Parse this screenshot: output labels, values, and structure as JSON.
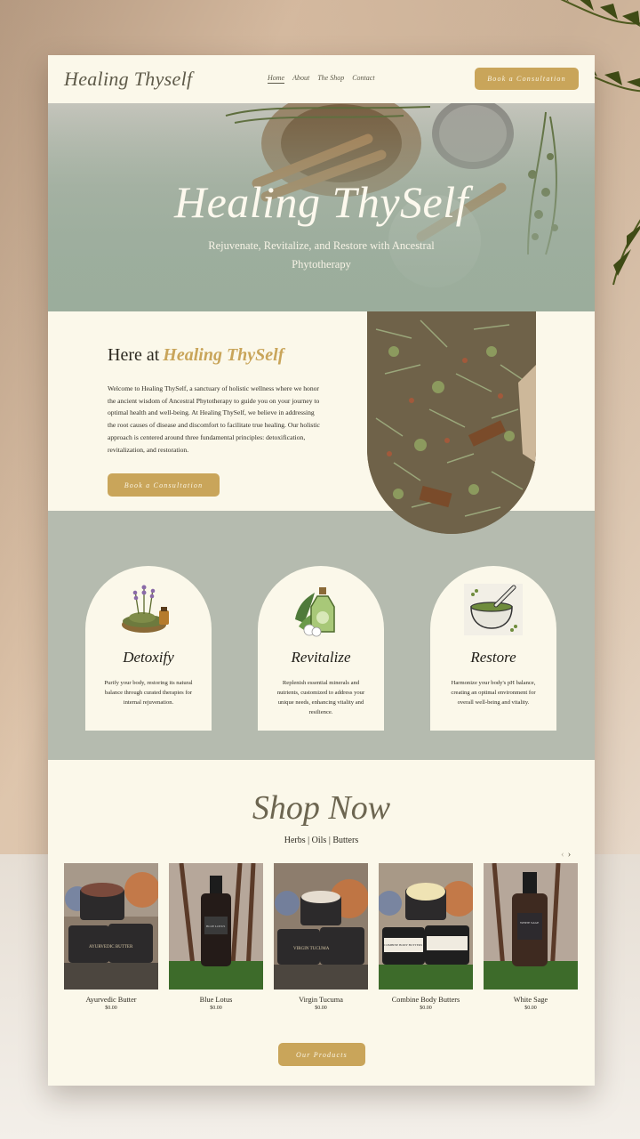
{
  "header": {
    "logo": "Healing Thyself",
    "nav": [
      "Home",
      "About",
      "The Shop",
      "Contact"
    ],
    "cta": "Book a Consultation"
  },
  "hero": {
    "title": "Healing ThySelf",
    "subtitle": "Rejuvenate, Revitalize, and Restore with Ancestral Phytotherapy"
  },
  "intro": {
    "heading_prefix": "Here at",
    "heading_brand": "Healing ThySelf",
    "body": "Welcome to Healing ThySelf, a sanctuary of holistic wellness where we honor the ancient wisdom of Ancestral Phytotherapy to guide you on your journey to optimal health and well-being. At Healing ThySelf, we believe in addressing the root causes of disease and discomfort to facilitate true healing. Our holistic approach is centered around three fundamental principles: detoxification, revitalization, and restoration.",
    "cta": "Book a Consultation"
  },
  "benefits": [
    {
      "title": "Detoxify",
      "text": "Purify your body, restoring its natural balance through curated therapies for internal rejuvenation.",
      "icon": "herbs-bowl-icon"
    },
    {
      "title": "Revitalize",
      "text": "Replenish essential minerals and nutrients, customized to address your unique needs, enhancing vitality and resilience.",
      "icon": "oil-bottle-icon"
    },
    {
      "title": "Restore",
      "text": "Harmonize your body's pH balance, creating an optimal environment for overall well-being and vitality.",
      "icon": "mortar-pestle-icon"
    }
  ],
  "shop": {
    "title": "Shop Now",
    "categories": "Herbs | Oils | Butters",
    "arrows": [
      "‹",
      "›"
    ],
    "products": [
      {
        "name": "Ayurvedic Butter",
        "price": "$0.00",
        "jar_label": "AYURVEDIC BUTTER"
      },
      {
        "name": "Blue Lotus",
        "price": "$0.00",
        "jar_label": "BLUE LOTUS"
      },
      {
        "name": "Virgin Tucuma",
        "price": "$0.00",
        "jar_label": "VIRGIN TUCUMA"
      },
      {
        "name": "Combine Body Butters",
        "price": "$0.00",
        "jar_label": "COMBINE BODY BUTTERS"
      },
      {
        "name": "White Sage",
        "price": "$0.00",
        "jar_label": "WHITE SAGE"
      }
    ],
    "cta": "Our Products"
  },
  "colors": {
    "accent": "#c9a55a",
    "cream": "#fbf8ea",
    "sage": "#b5bbaf",
    "text": "#2d2a21"
  }
}
